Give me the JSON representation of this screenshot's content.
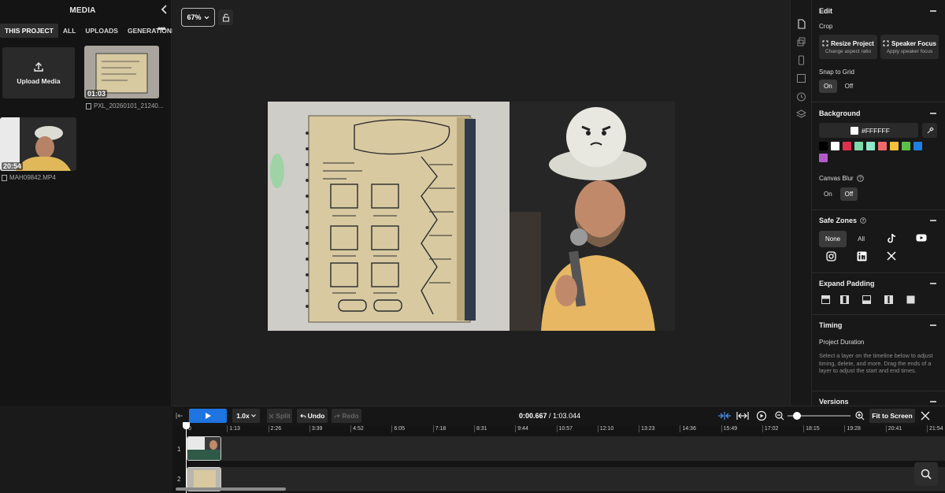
{
  "media": {
    "title": "MEDIA",
    "tabs": [
      "THIS PROJECT",
      "ALL",
      "UPLOADS",
      "GENERATIONS"
    ],
    "upload_label": "Upload Media",
    "items": [
      {
        "duration": "01:03",
        "filename": "PXL_20260101_21240..."
      },
      {
        "duration": "20:54",
        "filename": "MAH09842.MP4"
      }
    ]
  },
  "canvas": {
    "zoom": "67%"
  },
  "props": {
    "edit": "Edit",
    "crop": "Crop",
    "resize_title": "Resize Project",
    "resize_sub": "Change aspect ratio",
    "speaker_title": "Speaker Focus",
    "speaker_sub": "Apply speaker focus",
    "snap": "Snap to Grid",
    "on": "On",
    "off": "Off",
    "background": "Background",
    "bg_hex": "#FFFFFF",
    "swatches": [
      "#000000",
      "#ffffff",
      "#e0304e",
      "#7fd9a8",
      "#8fe8c9",
      "#f06a6a",
      "#f5c23a",
      "#5bbf4a",
      "#1f7fe0",
      "#b35acb"
    ],
    "canvas_blur": "Canvas Blur",
    "safe_zones": "Safe Zones",
    "none": "None",
    "all": "All",
    "expand_padding": "Expand Padding",
    "timing": "Timing",
    "project_duration": "Project Duration",
    "timing_help": "Select a layer on the timeline below to adjust timing, delete, and more. Drag the ends of a layer to adjust the start and end times.",
    "versions": "Versions"
  },
  "timeline": {
    "speed": "1.0x",
    "split": "Split",
    "undo": "Undo",
    "redo": "Redo",
    "current": "0:00.667",
    "total": "1:03.044",
    "fit": "Fit to Screen",
    "ticks": [
      "0",
      "1:13",
      "2:26",
      "3:39",
      "4:52",
      "6:05",
      "7:18",
      "8:31",
      "9:44",
      "10:57",
      "12:10",
      "13:23",
      "14:36",
      "15:49",
      "17:02",
      "18:15",
      "19:28",
      "20:41",
      "21:54"
    ],
    "tracks": [
      "1",
      "2"
    ]
  },
  "colors": {
    "accent": "#1e74e0",
    "panel": "#181818"
  }
}
